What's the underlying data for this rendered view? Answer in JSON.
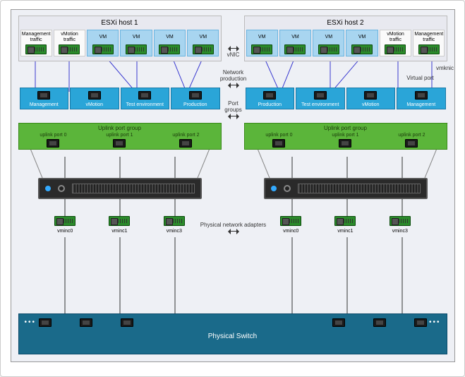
{
  "close": "×",
  "hosts": {
    "left": {
      "title": "ESXi host 1",
      "tiles": [
        "Management traffic",
        "vMotion traffic",
        "VM",
        "VM",
        "VM",
        "VM"
      ]
    },
    "right": {
      "title": "ESXi host 2",
      "tiles": [
        "VM",
        "VM",
        "VM",
        "VM",
        "vMotion traffic",
        "Management traffic"
      ]
    }
  },
  "portgroups": {
    "left": [
      "Management",
      "vMotion",
      "Test environment",
      "Production"
    ],
    "right": [
      "Production",
      "Test environment",
      "vMotion",
      "Management"
    ]
  },
  "uplink": {
    "title": "Uplink port group",
    "ports": [
      "uplink port 0",
      "uplink port 1",
      "uplink port 2"
    ]
  },
  "pnics": [
    "vminc0",
    "vminc1",
    "vminc3"
  ],
  "physwitch": "Physical Switch",
  "annotations": {
    "vnic": "vNIC",
    "netprod": "Network production",
    "pg": "Port groups",
    "pna": "Physical network adapters",
    "vport": "Virtual port",
    "vmknic": "vmknic"
  }
}
